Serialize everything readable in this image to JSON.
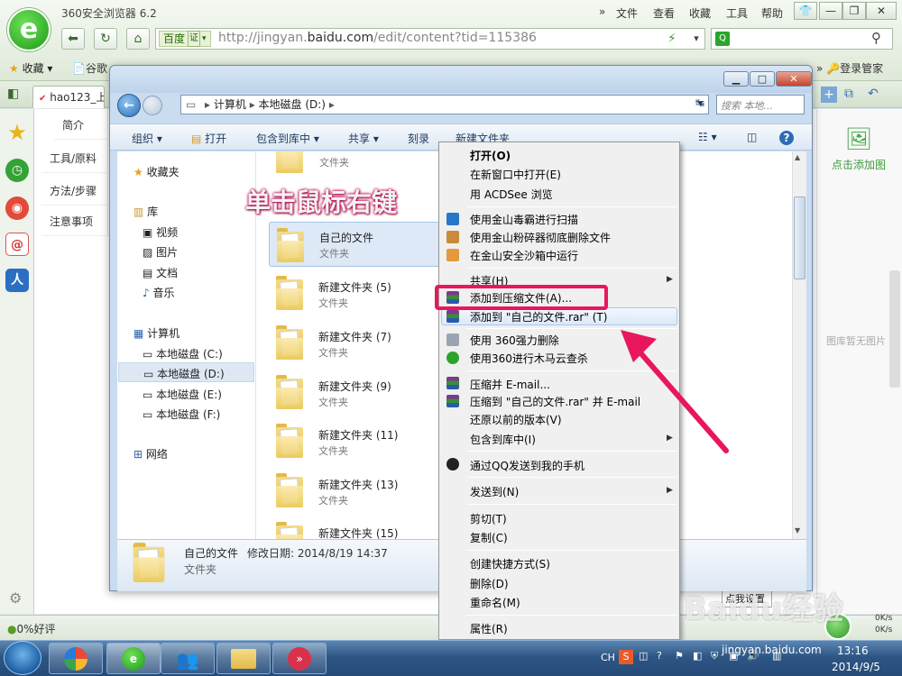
{
  "browser": {
    "title": "360安全浏览器 6.2",
    "menu": [
      "文件",
      "查看",
      "收藏",
      "工具",
      "帮助"
    ],
    "address": {
      "engine": "百度",
      "cert_badge": "证",
      "url_prefix": "http://jingyan.",
      "url_domain": "baidu.com",
      "url_suffix": "/edit/content?tid=115386"
    },
    "favorites_label": "收藏",
    "favorites_item": "谷歌",
    "login": "登录管家",
    "tab_label": "hao123_上"
  },
  "page": {
    "nav": [
      "简介",
      "工具/原料",
      "方法/步骤",
      "注意事项"
    ],
    "add_image": "点击添加图",
    "gallery_empty": "图库暂无图片",
    "status_rating": "0%好评",
    "net_up": "0K/s",
    "net_down": "0K/s",
    "save_tooltip": "点我设置"
  },
  "explorer": {
    "breadcrumb": [
      "计算机",
      "本地磁盘 (D:)"
    ],
    "search_placeholder": "搜索 本地...",
    "toolbar": [
      "组织",
      "打开",
      "包含到库中",
      "共享",
      "刻录",
      "新建文件夹"
    ],
    "nav": {
      "favorites": "收藏夹",
      "library": "库",
      "library_items": [
        "视频",
        "图片",
        "文档",
        "音乐"
      ],
      "computer": "计算机",
      "drives": [
        "本地磁盘 (C:)",
        "本地磁盘 (D:)",
        "本地磁盘 (E:)",
        "本地磁盘 (F:)"
      ],
      "network": "网络"
    },
    "files": [
      {
        "name": "",
        "type": "文件夹"
      },
      {
        "name": "自己的文件",
        "type": "文件夹"
      },
      {
        "name": "新建文件夹 (5)",
        "type": "文件夹"
      },
      {
        "name": "新建文件夹 (7)",
        "type": "文件夹"
      },
      {
        "name": "新建文件夹 (9)",
        "type": "文件夹"
      },
      {
        "name": "新建文件夹 (11)",
        "type": "文件夹"
      },
      {
        "name": "新建文件夹 (13)",
        "type": "文件夹"
      },
      {
        "name": "新建文件夹 (15)",
        "type": ""
      }
    ],
    "details": {
      "name": "自己的文件",
      "modified": "修改日期: 2014/8/19 14:37",
      "type": "文件夹"
    }
  },
  "context_menu": {
    "items": [
      {
        "label": "打开(O)",
        "bold": true
      },
      {
        "label": "在新窗口中打开(E)"
      },
      {
        "label": "用 ACDSee 浏览"
      },
      {
        "label": "使用金山毒霸进行扫描"
      },
      {
        "label": "使用金山粉碎器彻底删除文件"
      },
      {
        "label": "在金山安全沙箱中运行"
      },
      {
        "label": "共享(H)"
      },
      {
        "label": "添加到压缩文件(A)..."
      },
      {
        "label": "添加到 \"自己的文件.rar\" (T)"
      },
      {
        "label": "使用 360强力删除"
      },
      {
        "label": "使用360进行木马云查杀"
      },
      {
        "label": "压缩并 E-mail..."
      },
      {
        "label": "压缩到 \"自己的文件.rar\" 并 E-mail"
      },
      {
        "label": "还原以前的版本(V)"
      },
      {
        "label": "包含到库中(I)"
      },
      {
        "label": "通过QQ发送到我的手机"
      },
      {
        "label": "发送到(N)"
      },
      {
        "label": "剪切(T)"
      },
      {
        "label": "复制(C)"
      },
      {
        "label": "创建快捷方式(S)"
      },
      {
        "label": "删除(D)"
      },
      {
        "label": "重命名(M)"
      },
      {
        "label": "属性(R)"
      }
    ]
  },
  "annotation": "单击鼠标右键",
  "watermark": "Baidu经验",
  "watermark_url": "jingyan.baidu.com",
  "taskbar": {
    "lang": "CH",
    "time": "13:16",
    "date": "2014/9/5"
  },
  "colors": {
    "highlight": "#e8175d",
    "browser_green": "#1d9a17"
  }
}
